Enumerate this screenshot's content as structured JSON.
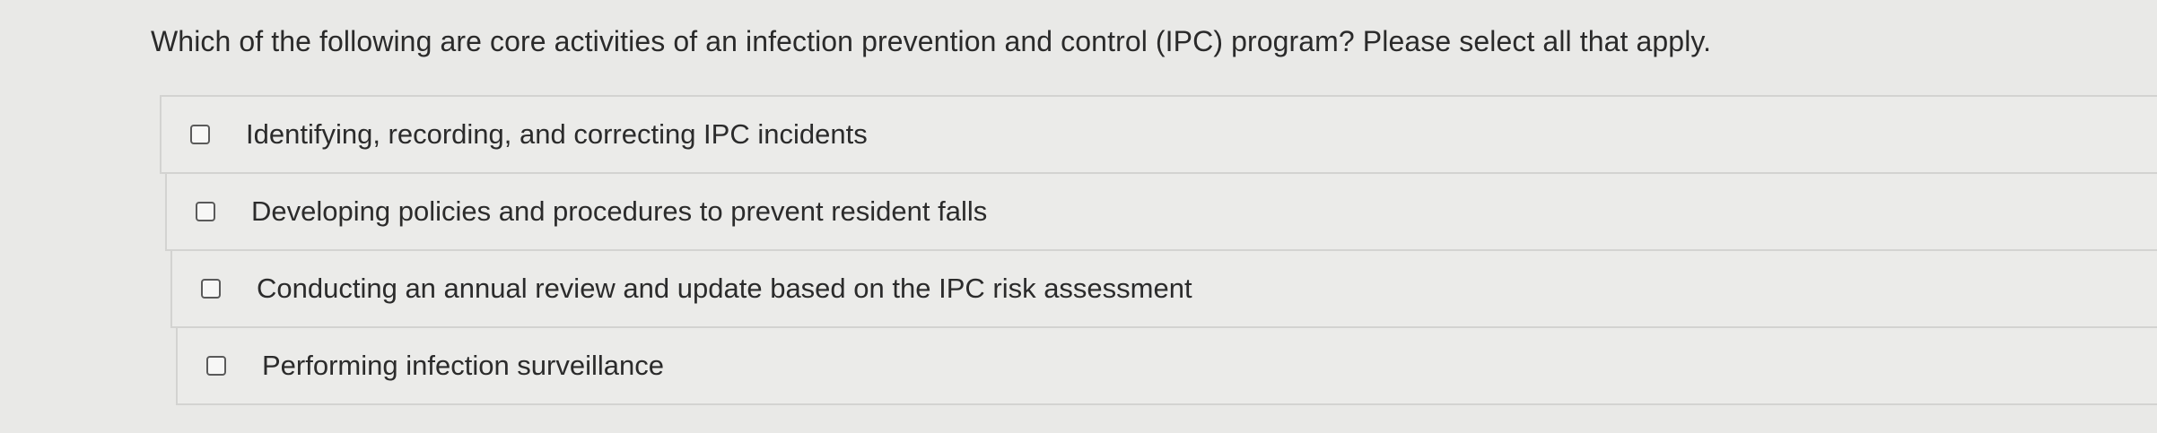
{
  "question": {
    "text": "Which of the following are core activities of an infection prevention and control (IPC) program? Please select all that apply."
  },
  "options": [
    {
      "label": "Identifying, recording, and correcting IPC incidents",
      "checked": false
    },
    {
      "label": "Developing policies and procedures to prevent resident falls",
      "checked": false
    },
    {
      "label": "Conducting an annual review and update based on the IPC risk assessment",
      "checked": false
    },
    {
      "label": "Performing infection surveillance",
      "checked": false
    }
  ]
}
